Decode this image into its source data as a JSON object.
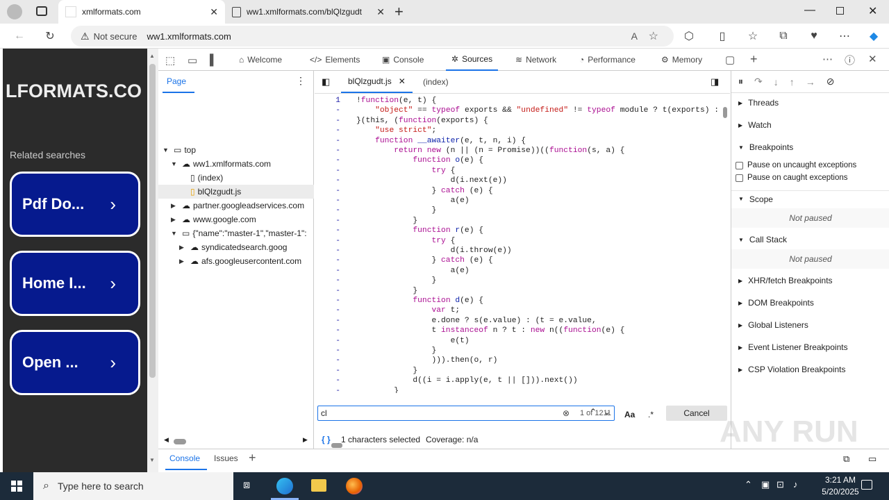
{
  "browser": {
    "tabs": [
      {
        "title": "xmlformats.com"
      },
      {
        "title": "ww1.xmlformats.com/blQlzgudt"
      }
    ],
    "address": {
      "security": "Not secure",
      "url": "ww1.xmlformats.com"
    }
  },
  "webpage": {
    "brand": "LFORMATS.CO",
    "related": "Related searches",
    "buttons": [
      "Pdf Do...",
      "Home I...",
      "Open ..."
    ]
  },
  "devtools": {
    "tabs": [
      "Welcome",
      "Elements",
      "Console",
      "Sources",
      "Network",
      "Performance",
      "Memory"
    ],
    "active_tab": "Sources",
    "nav": {
      "header": "Page",
      "tree": [
        "top",
        "ww1.xmlformats.com",
        "(index)",
        "blQlzgudt.js",
        "partner.googleadservices.com",
        "www.google.com",
        "{\"name\":\"master-1\",\"master-1\":",
        "syndicatedsearch.goog",
        "afs.googleusercontent.com"
      ]
    },
    "editor": {
      "file_tabs": [
        "blQlzgudt.js",
        "(index)"
      ],
      "line1": "1",
      "dash": "-",
      "search": {
        "value": "cl",
        "count": "1 of 1211",
        "case": "Aa",
        "regex": ".*",
        "cancel": "Cancel"
      },
      "status": {
        "braces": "{ }",
        "selected": "1 characters selected",
        "coverage": "Coverage: n/a"
      }
    },
    "debugger": {
      "sections": [
        "Threads",
        "Watch",
        "Breakpoints",
        "Scope",
        "Call Stack",
        "XHR/fetch Breakpoints",
        "DOM Breakpoints",
        "Global Listeners",
        "Event Listener Breakpoints",
        "CSP Violation Breakpoints"
      ],
      "pause_uncaught": "Pause on uncaught exceptions",
      "pause_caught": "Pause on caught exceptions",
      "not_paused": "Not paused"
    },
    "drawer": {
      "tabs": [
        "Console",
        "Issues"
      ]
    }
  },
  "taskbar": {
    "search_placeholder": "Type here to search",
    "time": "3:21 AM",
    "date": "5/20/2025"
  },
  "watermark": "ANY RUN"
}
